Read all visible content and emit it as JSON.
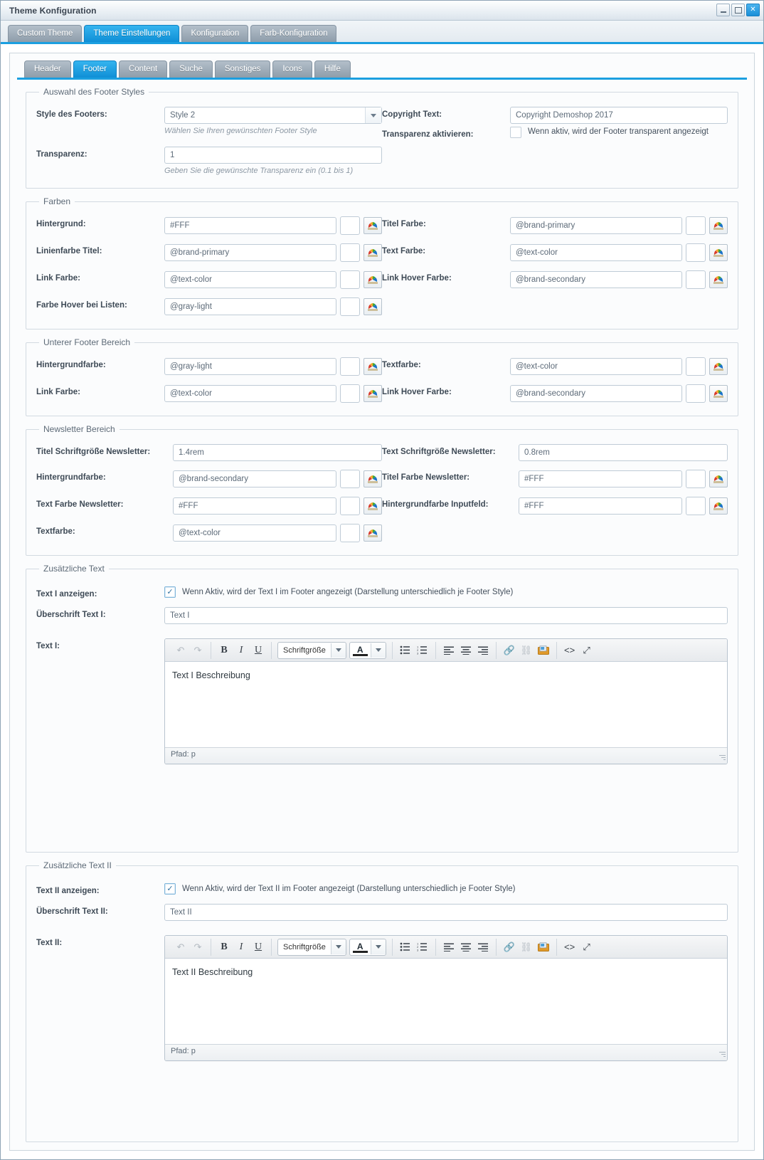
{
  "window": {
    "title": "Theme Konfiguration",
    "buttons": {
      "minimize": "minimize-button",
      "maximize": "maximize-button",
      "close": "close-button"
    }
  },
  "outer_tabs": [
    {
      "label": "Custom Theme",
      "active": false
    },
    {
      "label": "Theme Einstellungen",
      "active": true
    },
    {
      "label": "Konfiguration",
      "active": false
    },
    {
      "label": "Farb-Konfiguration",
      "active": false
    }
  ],
  "inner_tabs": [
    {
      "label": "Header",
      "active": false
    },
    {
      "label": "Footer",
      "active": true
    },
    {
      "label": "Content",
      "active": false
    },
    {
      "label": "Suche",
      "active": false
    },
    {
      "label": "Sonstiges",
      "active": false
    },
    {
      "label": "Icons",
      "active": false
    },
    {
      "label": "Hilfe",
      "active": false
    }
  ],
  "section_footer_style": {
    "legend": "Auswahl des Footer Styles",
    "style_label": "Style des Footers:",
    "style_value": "Style 2",
    "style_hint": "Wählen Sie Ihren gewünschten Footer Style",
    "copyright_label": "Copyright Text:",
    "copyright_value": "Copyright Demoshop 2017",
    "transparenz_aktivieren_label": "Transparenz aktivieren:",
    "transparenz_aktivieren_text": "Wenn aktiv, wird der Footer transparent angezeigt",
    "transparenz_aktivieren_checked": false,
    "transparenz_label": "Transparenz:",
    "transparenz_value": "1",
    "transparenz_hint": "Geben Sie die gewünschte Transparenz ein (0.1 bis 1)"
  },
  "section_farben": {
    "legend": "Farben",
    "fields": [
      {
        "label": "Hintergrund:",
        "value": "#FFF"
      },
      {
        "label": "Titel Farbe:",
        "value": "@brand-primary"
      },
      {
        "label": "Linienfarbe Titel:",
        "value": "@brand-primary"
      },
      {
        "label": "Text Farbe:",
        "value": "@text-color"
      },
      {
        "label": "Link Farbe:",
        "value": "@text-color"
      },
      {
        "label": "Link Hover Farbe:",
        "value": "@brand-secondary"
      },
      {
        "label": "Farbe Hover bei Listen:",
        "value": "@gray-light"
      }
    ]
  },
  "section_unterer_footer": {
    "legend": "Unterer Footer Bereich",
    "fields": [
      {
        "label": "Hintergrundfarbe:",
        "value": "@gray-light"
      },
      {
        "label": "Textfarbe:",
        "value": "@text-color"
      },
      {
        "label": "Link Farbe:",
        "value": "@text-color"
      },
      {
        "label": "Link Hover Farbe:",
        "value": "@brand-secondary"
      }
    ]
  },
  "section_newsletter": {
    "legend": "Newsletter Bereich",
    "titel_schriftgroesse_label": "Titel Schriftgröße Newsletter:",
    "titel_schriftgroesse_value": "1.4rem",
    "text_schriftgroesse_label": "Text Schriftgröße Newsletter:",
    "text_schriftgroesse_value": "0.8rem",
    "fields": [
      {
        "label": "Hintergrundfarbe:",
        "value": "@brand-secondary"
      },
      {
        "label": "Titel Farbe Newsletter:",
        "value": "#FFF"
      },
      {
        "label": "Text Farbe Newsletter:",
        "value": "#FFF"
      },
      {
        "label": "Hintergrundfarbe Inputfeld:",
        "value": "#FFF"
      },
      {
        "label": "Textfarbe:",
        "value": "@text-color"
      }
    ]
  },
  "section_text1": {
    "legend": "Zusätzliche Text",
    "show_label": "Text I anzeigen:",
    "show_text": "Wenn Aktiv, wird der Text I im Footer angezeigt (Darstellung unterschiedlich je Footer Style)",
    "show_checked": true,
    "heading_label": "Überschrift Text I:",
    "heading_value": "Text I",
    "text_label": "Text I:",
    "editor_content": "Text I Beschreibung",
    "status": "Pfad: p"
  },
  "section_text2": {
    "legend": "Zusätzliche Text II",
    "show_label": "Text II anzeigen:",
    "show_text": "Wenn Aktiv, wird der Text II im Footer angezeigt (Darstellung unterschiedlich je Footer Style)",
    "show_checked": true,
    "heading_label": "Überschrift Text II:",
    "heading_value": "Text II",
    "text_label": "Text II:",
    "editor_content": "Text II Beschreibung",
    "status": "Pfad: p"
  },
  "editor_toolbar": {
    "undo": "undo-icon",
    "redo": "redo-icon",
    "bold": "B",
    "italic": "I",
    "underline": "U",
    "fontsize_label": "Schriftgröße",
    "forecolor": "A",
    "bullet_list": "unordered-list-icon",
    "number_list": "ordered-list-icon",
    "align_left": "align-left-icon",
    "align_center": "align-center-icon",
    "align_right": "align-right-icon",
    "link": "link-icon",
    "unlink": "unlink-icon",
    "image": "image-icon",
    "source": "source-code-icon",
    "fullscreen": "fullscreen-icon"
  },
  "colors": {
    "accent": "#1b9fe0",
    "tab_inactive": "#8e9daa",
    "border": "#d2dae1",
    "label_text": "#3e4a56",
    "input_text": "#5d6b79"
  }
}
